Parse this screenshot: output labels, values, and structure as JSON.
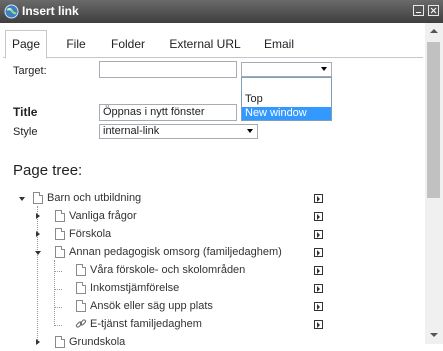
{
  "window": {
    "title": "Insert link"
  },
  "tabs": [
    {
      "label": "Page",
      "active": true
    },
    {
      "label": "File",
      "active": false
    },
    {
      "label": "Folder",
      "active": false
    },
    {
      "label": "External URL",
      "active": false
    },
    {
      "label": "Email",
      "active": false
    }
  ],
  "form": {
    "target_label": "Target:",
    "target_value": "",
    "target_select_value": "",
    "target_options": [
      "Top",
      "New window"
    ],
    "target_highlighted": "New window",
    "title_label": "Title",
    "title_value": "Öppnas i nytt fönster",
    "style_label": "Style",
    "style_value": "internal-link"
  },
  "page_tree": {
    "heading": "Page tree:",
    "nodes": [
      {
        "label": "Barn och utbildning",
        "level": 0,
        "expanded": true,
        "type": "page"
      },
      {
        "label": "Vanliga frågor",
        "level": 1,
        "expanded": false,
        "type": "page"
      },
      {
        "label": "Förskola",
        "level": 1,
        "expanded": false,
        "type": "page"
      },
      {
        "label": "Annan pedagogisk omsorg (familjedaghem)",
        "level": 1,
        "expanded": true,
        "type": "page"
      },
      {
        "label": "Våra förskole- och skolområden",
        "level": 2,
        "type": "page"
      },
      {
        "label": "Inkomstjämförelse",
        "level": 2,
        "type": "page"
      },
      {
        "label": "Ansök eller säg upp plats",
        "level": 2,
        "type": "page"
      },
      {
        "label": "E-tjänst familjedaghem",
        "level": 2,
        "type": "link"
      },
      {
        "label": "Grundskola",
        "level": 1,
        "expanded": false,
        "type": "page"
      }
    ]
  },
  "icons": {
    "window": "globe-icon",
    "minimize": "minimize-icon",
    "close": "close-icon",
    "page": "page-icon",
    "link": "link-icon",
    "node_menu": "node-menu-icon"
  }
}
